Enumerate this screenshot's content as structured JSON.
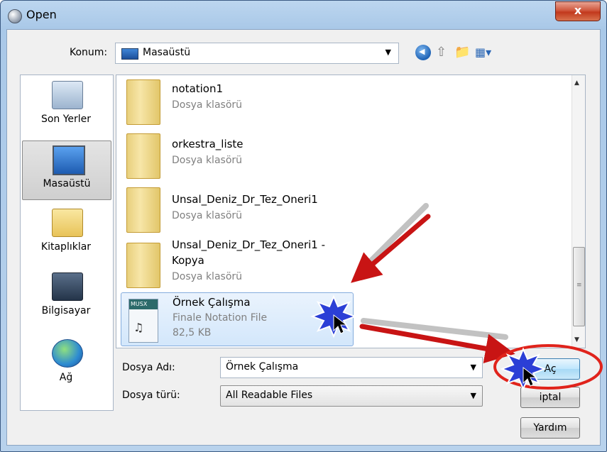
{
  "window": {
    "title": "Open",
    "close_label": "x"
  },
  "toolbar": {
    "konum_label": "Konum:",
    "konum_value": "Masaüstü",
    "icons": [
      "back-icon",
      "up-folder-icon",
      "new-folder-icon",
      "view-menu-icon"
    ]
  },
  "places": [
    {
      "label": "Son Yerler",
      "icon": "recent-places-icon"
    },
    {
      "label": "Masaüstü",
      "icon": "desktop-icon",
      "selected": true
    },
    {
      "label": "Kitaplıklar",
      "icon": "libraries-icon"
    },
    {
      "label": "Bilgisayar",
      "icon": "computer-icon"
    },
    {
      "label": "Ağ",
      "icon": "network-icon"
    }
  ],
  "files": [
    {
      "name": "notation1",
      "type": "Dosya klasörü"
    },
    {
      "name": "orkestra_liste",
      "type": "Dosya klasörü"
    },
    {
      "name": "Unsal_Deniz_Dr_Tez_Oneri1",
      "type": "Dosya klasörü"
    },
    {
      "name": "Unsal_Deniz_Dr_Tez_Oneri1 -",
      "name2": "Kopya",
      "type": "Dosya klasörü"
    },
    {
      "name": "Örnek Çalışma",
      "type": "Finale Notation File",
      "size": "82,5 KB",
      "icon_label": "MUSX",
      "selected": true
    }
  ],
  "form": {
    "filename_label": "Dosya Adı:",
    "filename_value": "Örnek Çalışma",
    "filetype_label": "Dosya türü:",
    "filetype_value": "All Readable Files"
  },
  "buttons": {
    "open": "Aç",
    "cancel": "iptal",
    "help": "Yardım"
  },
  "colors": {
    "annotation_arrow": "#c81414",
    "annotation_circle": "#e0231b",
    "burst": "#2b3fd6"
  }
}
